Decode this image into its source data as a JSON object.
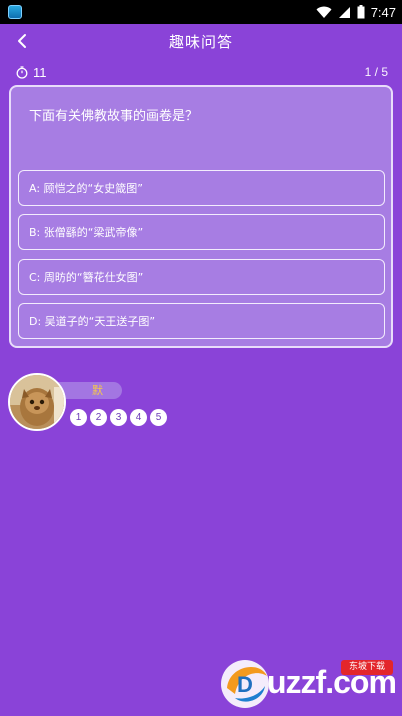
{
  "status_bar": {
    "time": "7:47",
    "icons": [
      "app-notification-icon",
      "wifi-icon",
      "signal-icon",
      "battery-icon"
    ]
  },
  "header": {
    "back_icon": "chevron-left-icon",
    "title": "趣味问答"
  },
  "quiz": {
    "timer_icon": "stopwatch-icon",
    "timer": "11",
    "progress": "1 / 5",
    "question": "下面有关佛教故事的画卷是？",
    "options": [
      {
        "label": "A: 顾恺之的“女史箴图”"
      },
      {
        "label": "B: 张僧繇的“梁武帝像”"
      },
      {
        "label": "C: 周昉的“簪花仕女图”"
      },
      {
        "label": "D: 吴道子的“天王送子图”"
      }
    ]
  },
  "player": {
    "name": "默",
    "rounds": [
      "1",
      "2",
      "3",
      "4",
      "5"
    ]
  },
  "watermark": {
    "text": "uzzf.com",
    "badge": "东坡下载"
  },
  "colors": {
    "background": "#8a43d8",
    "card": "#a77de3",
    "name": "#f5c84a"
  }
}
